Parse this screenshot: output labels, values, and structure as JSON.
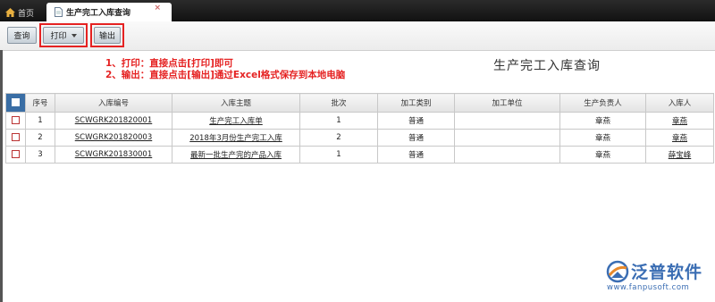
{
  "tabs": {
    "home_label": "首页",
    "active_label": "生产完工入库查询",
    "close_glyph": "×"
  },
  "toolbar": {
    "query_label": "查询",
    "print_label": "打印",
    "export_label": "输出"
  },
  "instructions": [
    "1、打印：直接点击[打印]即可",
    "2、输出：直接点击[输出]通过Excel格式保存到本地电脑"
  ],
  "page_title": "生产完工入库查询",
  "table": {
    "columns": [
      "序号",
      "入库编号",
      "入库主题",
      "批次",
      "加工类别",
      "加工单位",
      "生产负责人",
      "入库人"
    ],
    "rows": [
      {
        "no": "1",
        "code": "SCWGRK201820001",
        "subject": "生产完工入库单",
        "batch": "1",
        "category": "普通",
        "unit": "",
        "manager": "章燕",
        "receiver": "章燕"
      },
      {
        "no": "2",
        "code": "SCWGRK201820003",
        "subject": "2018年3月份生产完工入库",
        "batch": "2",
        "category": "普通",
        "unit": "",
        "manager": "章燕",
        "receiver": "章燕"
      },
      {
        "no": "3",
        "code": "SCWGRK201830001",
        "subject": "最新一批生产完的产品入库",
        "batch": "1",
        "category": "普通",
        "unit": "",
        "manager": "章燕",
        "receiver": "薛宝峰"
      }
    ]
  },
  "logo": {
    "name": "泛普软件",
    "url": "www.fanpusoft.com"
  },
  "colors": {
    "highlight": "#e52222",
    "brand": "#3a6db3",
    "tabbar": "#1a1a1a"
  }
}
